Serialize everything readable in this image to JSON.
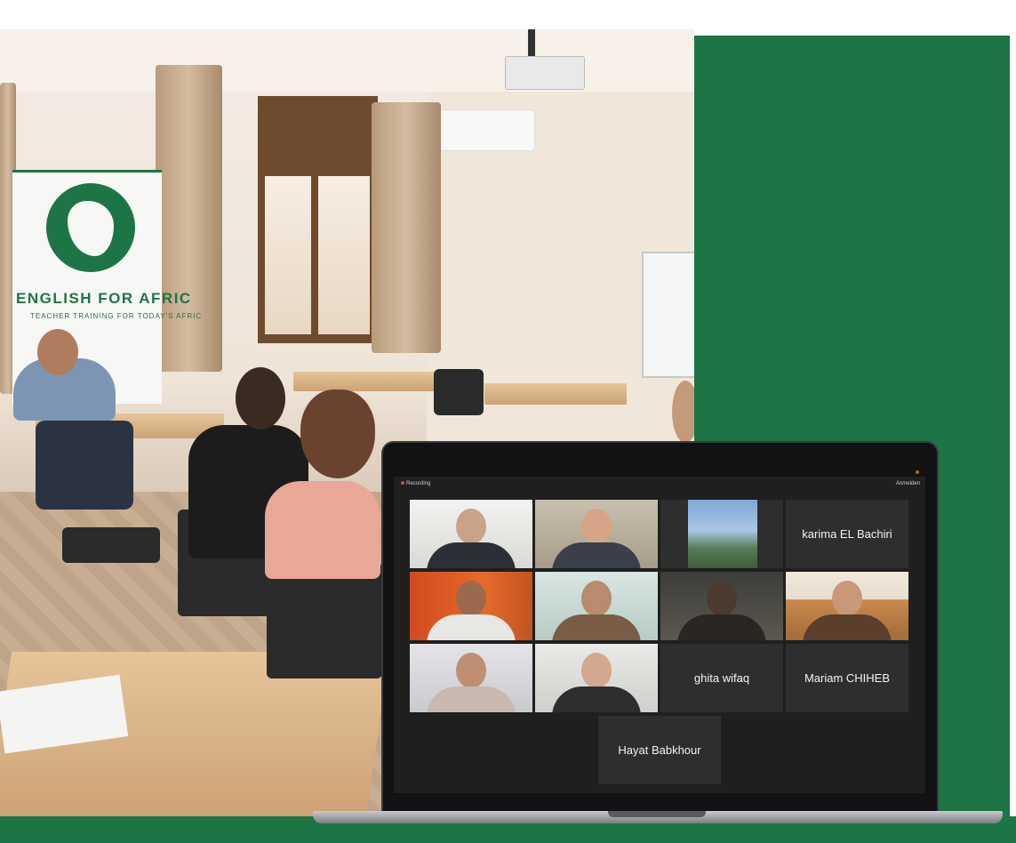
{
  "colors": {
    "brand_green": "#1d7546",
    "screen_bg": "#1f1f1f",
    "tile_bg": "#2e2e2e"
  },
  "banner": {
    "title": "ENGLISH FOR AFRIC",
    "subtitle": "TEACHER TRAINING FOR TODAY'S AFRIC",
    "logo_icon": "africa-map-icon"
  },
  "meeting": {
    "recording_label": "Recording",
    "signin_label": "Anmelden",
    "participants": [
      {
        "kind": "video"
      },
      {
        "kind": "video"
      },
      {
        "kind": "image"
      },
      {
        "kind": "name",
        "name": "karima EL Bachiri"
      },
      {
        "kind": "video"
      },
      {
        "kind": "video"
      },
      {
        "kind": "video"
      },
      {
        "kind": "video"
      },
      {
        "kind": "video"
      },
      {
        "kind": "video"
      },
      {
        "kind": "name",
        "name": "ghita wifaq"
      },
      {
        "kind": "name",
        "name": "Mariam CHIHEB"
      },
      {
        "kind": "name",
        "name": "Hayat Babkhour"
      }
    ]
  }
}
